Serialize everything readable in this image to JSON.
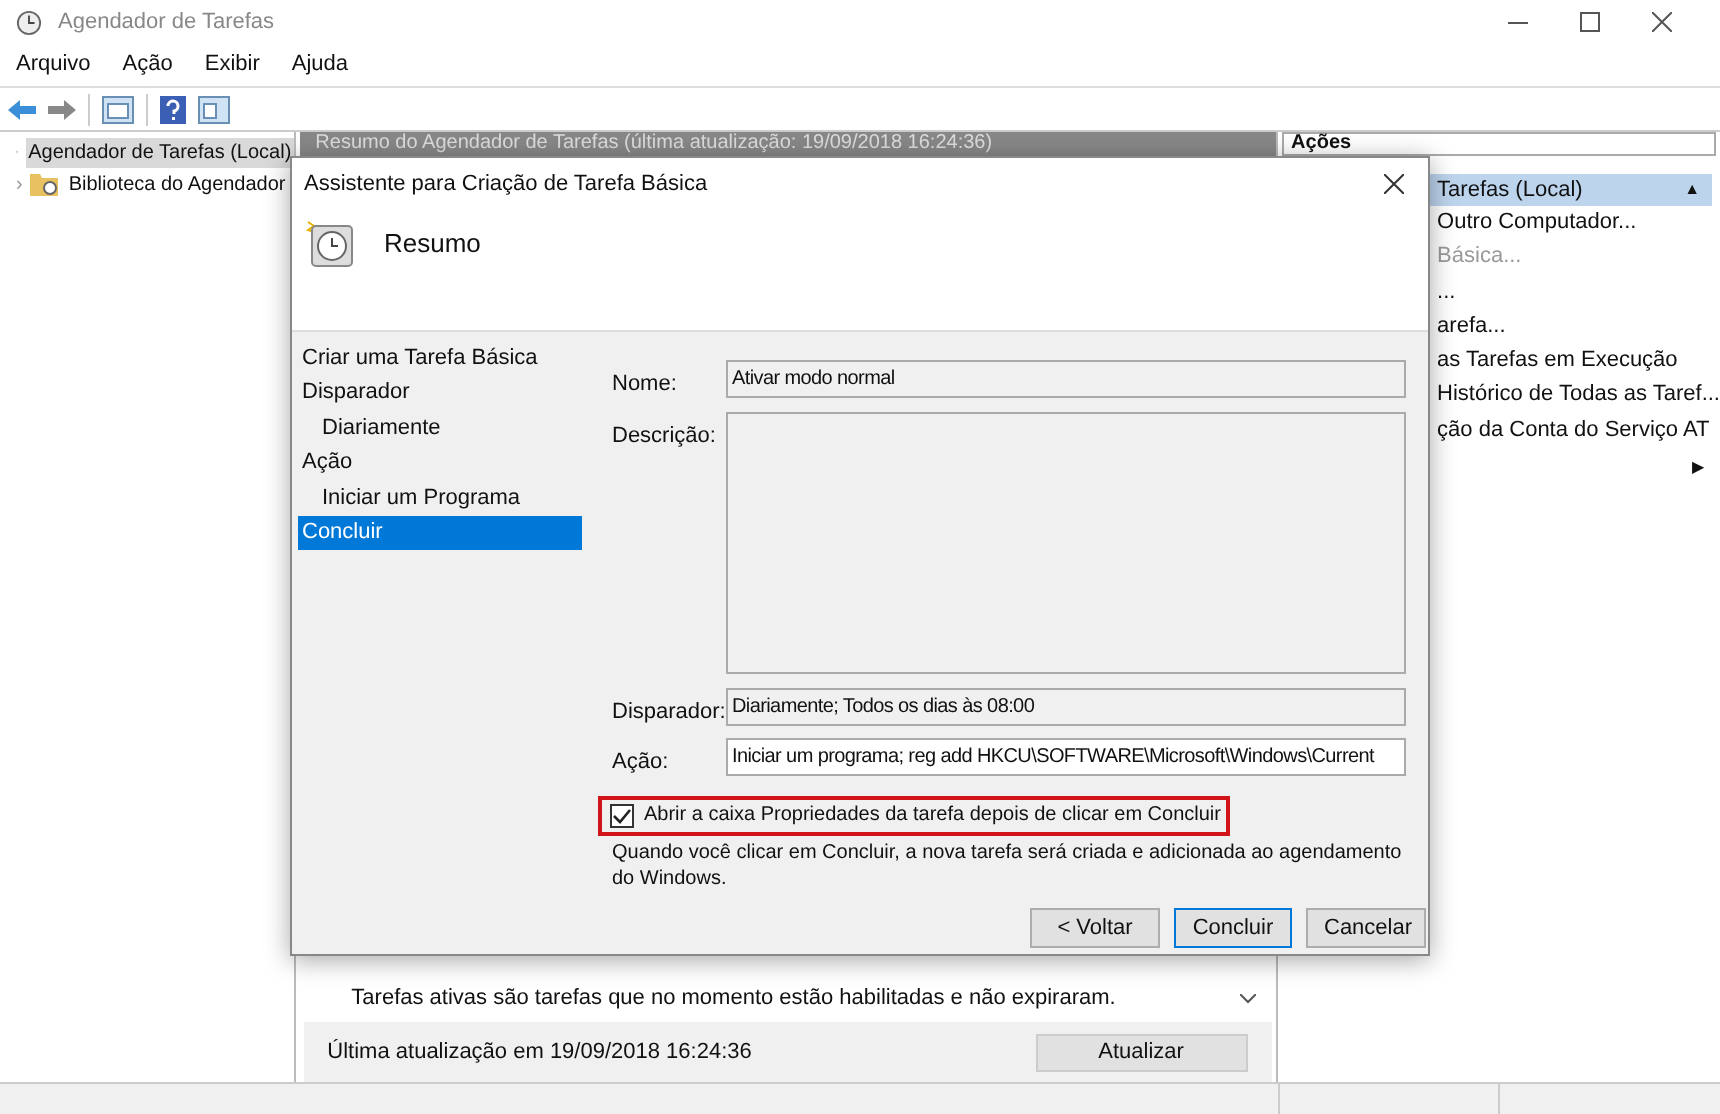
{
  "window": {
    "title": "Agendador de Tarefas"
  },
  "menu": [
    "Arquivo",
    "Ação",
    "Exibir",
    "Ajuda"
  ],
  "tree": [
    {
      "label": "Agendador de Tarefas (Local)",
      "selected": true,
      "children": [
        {
          "label": "Biblioteca do Agendador",
          "selected": false,
          "toggle": "›"
        }
      ]
    }
  ],
  "center": {
    "header": "Resumo do Agendador de Tarefas (última atualização: 19/09/2018 16:24:36)",
    "note": "Tarefas ativas são tarefas que no momento estão habilitadas e não expiraram.",
    "last_update": "Última atualização em 19/09/2018 16:24:36",
    "refresh_button": "Atualizar"
  },
  "actions": {
    "header": "Ações",
    "items": [
      {
        "label": "Tarefas (Local)",
        "kind": "section",
        "toggle": "▲"
      },
      {
        "label": "Outro Computador...",
        "kind": "item",
        "disabled": false
      },
      {
        "label": "Básica...",
        "kind": "item",
        "disabled": true
      },
      {
        "label": "...",
        "kind": "item",
        "disabled": false
      },
      {
        "label": "arefa...",
        "kind": "item",
        "disabled": false
      },
      {
        "label": "as Tarefas em Execução",
        "kind": "item",
        "disabled": false
      },
      {
        "label": "Histórico de Todas as Taref...",
        "kind": "item",
        "disabled": false
      },
      {
        "label": "ção da Conta do Serviço AT",
        "kind": "item",
        "disabled": false
      },
      {
        "label": "▶",
        "kind": "submenu"
      }
    ]
  },
  "dialog": {
    "title": "Assistente para Criação de Tarefa Básica",
    "heading": "Resumo",
    "steps": [
      {
        "label": "Criar uma Tarefa Básica",
        "selected": false
      },
      {
        "label": "Disparador",
        "selected": false,
        "children": [
          {
            "label": "Diariamente",
            "selected": false
          }
        ]
      },
      {
        "label": "Ação",
        "selected": false,
        "children": [
          {
            "label": "Iniciar um Programa",
            "selected": false
          }
        ]
      },
      {
        "label": "Concluir",
        "selected": true
      }
    ],
    "fields": [
      {
        "label": "Nome:",
        "value": "Ativar modo normal",
        "kind": "line"
      },
      {
        "label": "Descrição:",
        "kind": "area"
      },
      {
        "label": "Disparador:",
        "value": "Diariamente; Todos os dias às 08:00",
        "kind": "line"
      },
      {
        "label": "Ação:",
        "value": "Iniciar um programa; reg add HKCU\\SOFTWARE\\Microsoft\\Windows\\Current",
        "kind": "line"
      }
    ],
    "checkbox": {
      "label": "Abrir a caixa Propriedades da tarefa depois de clicar em Concluir",
      "checked": true
    },
    "info": "Quando você clicar em Concluir, a nova tarefa será criada e adicionada ao agendamento do Windows.",
    "buttons": [
      {
        "label": "< Voltar",
        "default": false
      },
      {
        "label": "Concluir",
        "default": true
      },
      {
        "label": "Cancelar",
        "default": false
      }
    ]
  }
}
